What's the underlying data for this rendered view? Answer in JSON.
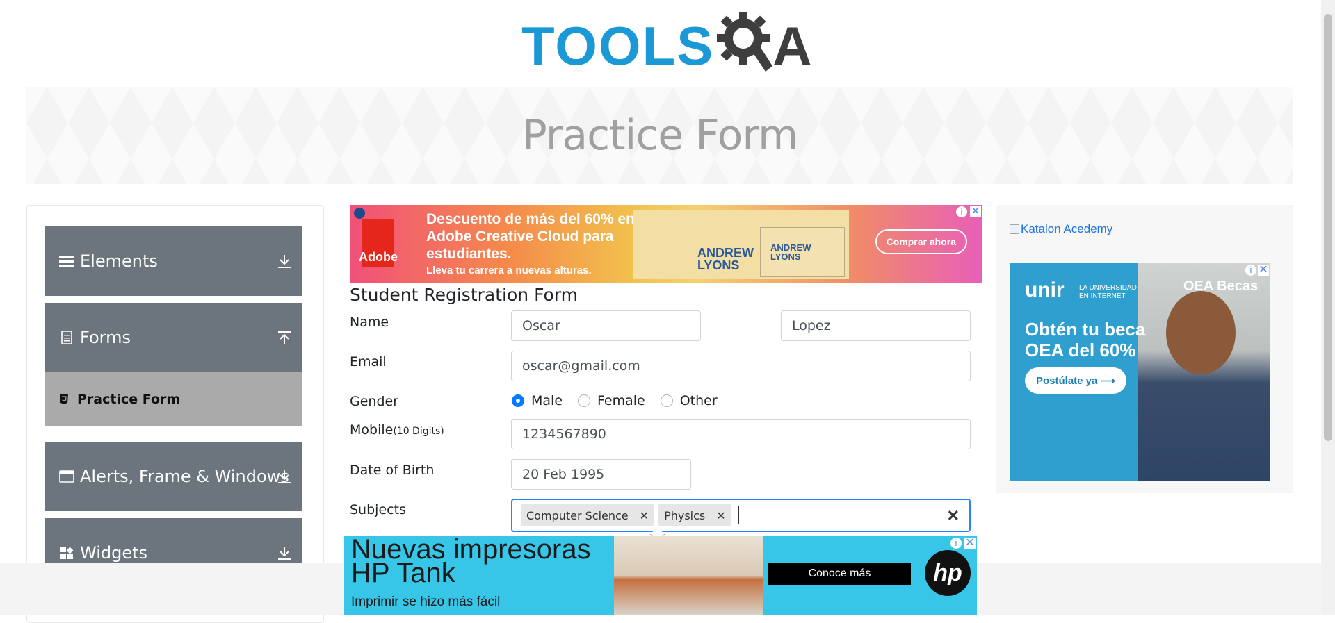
{
  "logo": {
    "tools_text": "TOOLS",
    "gear_icon": "gear-magnifier-icon",
    "a_text": "A",
    "colors": {
      "tools": "#1a99d6",
      "qa": "#3e3e3e"
    }
  },
  "banner": {
    "title": "Practice Form"
  },
  "sidebar": {
    "groups": [
      {
        "label": "Elements",
        "icon": "hamburger-icon",
        "arrow": "download-arrow-icon"
      },
      {
        "label": "Forms",
        "icon": "document-icon",
        "arrow": "upload-arrow-icon"
      },
      {
        "label": "Alerts, Frame & Windows",
        "icon": "window-icon",
        "arrow": "download-arrow-icon"
      },
      {
        "label": "Widgets",
        "icon": "grid-icon",
        "arrow": "download-arrow-icon"
      }
    ],
    "active_item": {
      "label": "Practice Form",
      "icon": "html5-icon"
    }
  },
  "ads": {
    "top": {
      "brand": "Adobe",
      "headline": "Descuento de más del 60% en Adobe Creative Cloud para estudiantes.",
      "subline": "Lleva tu carrera a nuevas alturas.",
      "name_large": "ANDREW LYONS",
      "name_small": "ANDREW LYONS",
      "button": "Comprar ahora"
    },
    "right": {
      "broken_image_alt": "Katalon Acedemy",
      "brand": "unir",
      "brand_sub": "LA UNIVERSIDAD EN INTERNET",
      "partner": "OEA Becas",
      "headline": "Obtén tu beca OEA del 60%",
      "button": "Postúlate ya ⟶"
    },
    "bottom": {
      "headline": "Nuevas impresoras HP Tank",
      "subline": "Imprimir se hizo más fácil",
      "button": "Conoce más",
      "brand": "hp"
    }
  },
  "form": {
    "title": "Student Registration Form",
    "name_label": "Name",
    "first_name": "Oscar",
    "last_name": "Lopez",
    "email_label": "Email",
    "email": "oscar@gmail.com",
    "gender_label": "Gender",
    "gender_options": [
      "Male",
      "Female",
      "Other"
    ],
    "gender_selected": "Male",
    "mobile_label": "Mobile",
    "mobile_hint": "(10 Digits)",
    "mobile": "1234567890",
    "dob_label": "Date of Birth",
    "dob": "20 Feb 1995",
    "subjects_label": "Subjects",
    "subjects": [
      "Computer Science",
      "Physics"
    ]
  }
}
